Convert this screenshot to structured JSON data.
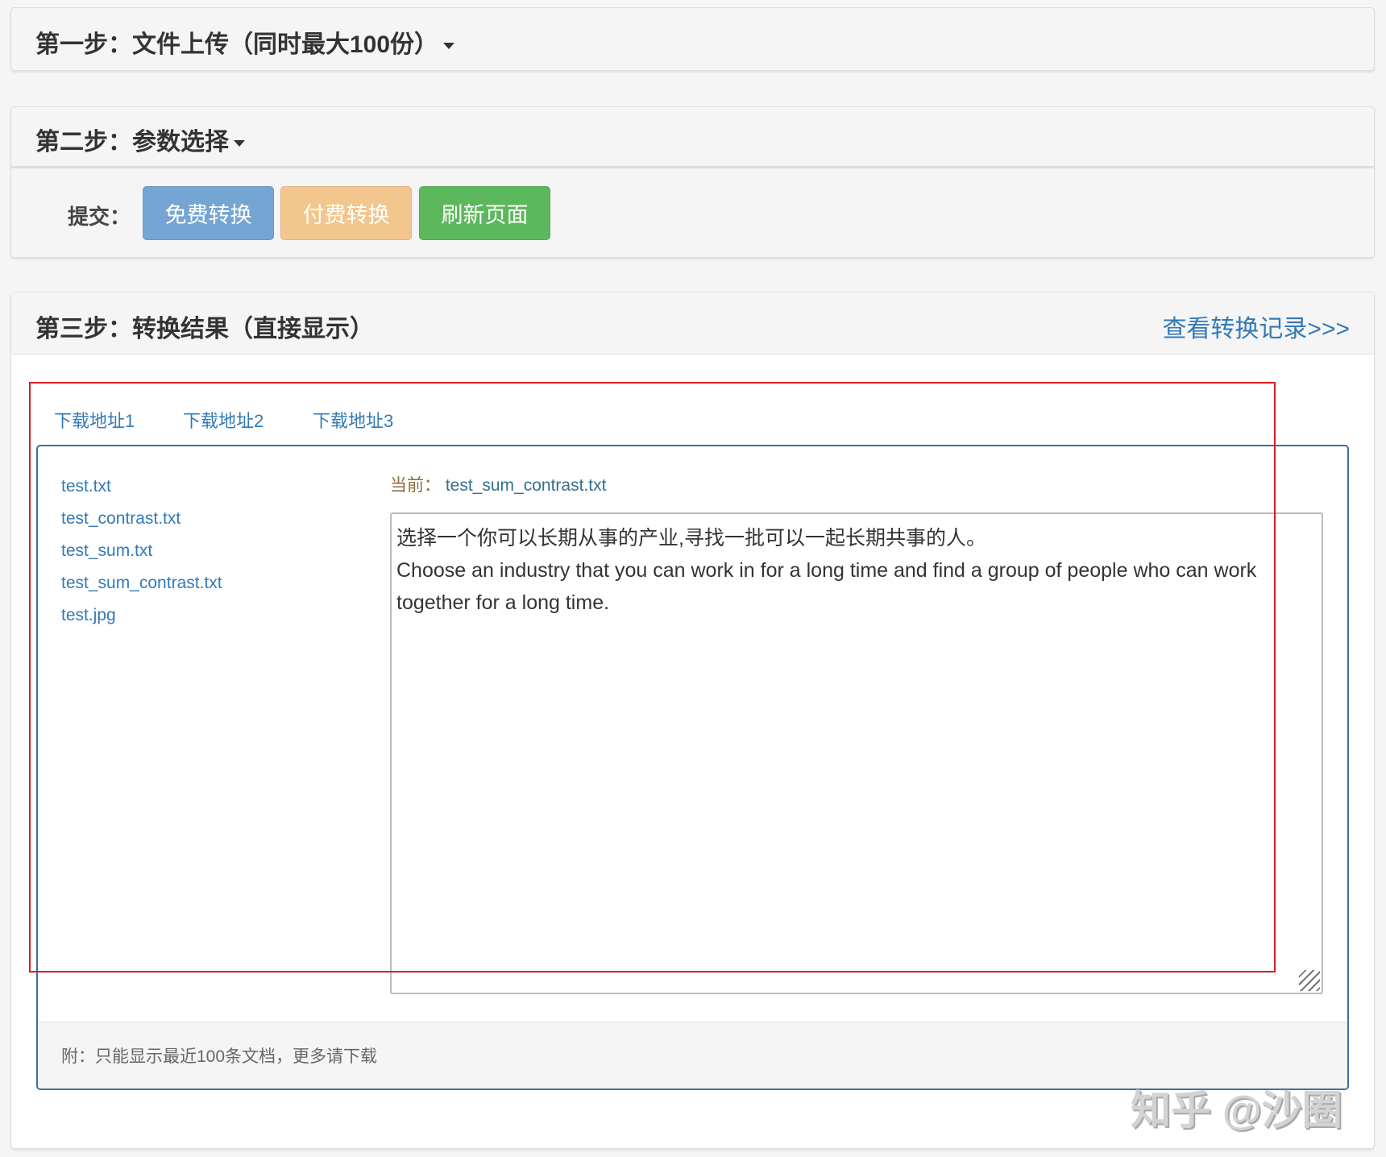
{
  "step1": {
    "title": "第一步：文件上传（同时最大100份）"
  },
  "step2": {
    "title": "第二步：参数选择",
    "submit_label": "提交：",
    "buttons": [
      {
        "label": "免费转换",
        "color": "#75a5d2"
      },
      {
        "label": "付费转换",
        "color": "#f2c68c"
      },
      {
        "label": "刷新页面",
        "color": "#5cb85c"
      }
    ]
  },
  "step3": {
    "title": "第三步：转换结果（直接显示）",
    "history_link": "查看转换记录>>>",
    "tabs": [
      "下载地址1",
      "下载地址2",
      "下载地址3"
    ],
    "files": [
      "test.txt",
      "test_contrast.txt",
      "test_sum.txt",
      "test_sum_contrast.txt",
      "test.jpg"
    ],
    "current_label": "当前：",
    "current_file": "test_sum_contrast.txt",
    "content": "选择一个你可以长期从事的产业,寻找一批可以一起长期共事的人。\nChoose an industry that you can work in for a long time and find a group of people who can work together for a long time.",
    "footer_note": "附：只能显示最近100条文档，更多请下载"
  },
  "watermark": "知乎 @沙圈"
}
